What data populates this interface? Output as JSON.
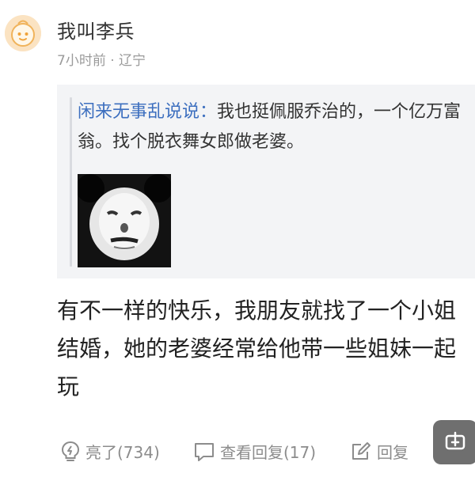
{
  "comment": {
    "author": "我叫李兵",
    "time": "7小时前",
    "separator": "·",
    "location": "辽宁",
    "quote": {
      "user": "闲来无事乱说说",
      "colon": "：",
      "text": "我也挺佩服乔治的，一个亿万富翁。找个脱衣舞女郎做老婆。"
    },
    "content": "有不一样的快乐，我朋友就找了一个小姐结婚，她的老婆经常给他带一些姐妹一起玩"
  },
  "actions": {
    "like_label": "亮了(734)",
    "replies_label": "查看回复(17)",
    "reply_label": "回复"
  },
  "icons": {
    "avatar": "avatar",
    "like": "lightbulb-icon",
    "replies": "comment-icon",
    "reply": "edit-icon",
    "float": "float-action-icon"
  },
  "colors": {
    "username_link": "#3d6fbf",
    "quote_bg": "#f3f4f6",
    "meta_text": "#9b9b9b",
    "action_text": "#8c8c8c"
  }
}
